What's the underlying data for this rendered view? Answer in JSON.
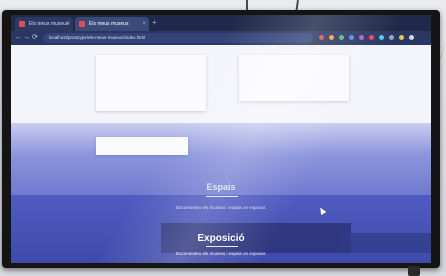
{
  "browser": {
    "tabs": [
      {
        "label": "Els meus museus",
        "active": false
      },
      {
        "label": "Els meus museus",
        "active": true
      }
    ],
    "new_tab_symbol": "+",
    "address": "localhost/prototype/els-meus-museus/index.html",
    "nav": {
      "back": "←",
      "forward": "→",
      "reload": "⟳"
    },
    "tab_close": "×",
    "extension_colors": [
      "#e24d4d",
      "#f0a63a",
      "#5bbd6a",
      "#4d8fe2",
      "#b05fd6",
      "#e24d4d",
      "#4dd0e2",
      "#9aa4c7",
      "#e2c84d",
      "#d7d7d7"
    ]
  },
  "page": {
    "section1": {
      "title": "Espais",
      "subtitle": "Documenteu els museus i espais on exposar."
    },
    "section2": {
      "title": "Exposició",
      "subtitle": "Documenteu els museus i espais on exposar."
    }
  },
  "colors": {
    "accent": "#4f5bc0",
    "browser_frame": "#2a3763"
  }
}
